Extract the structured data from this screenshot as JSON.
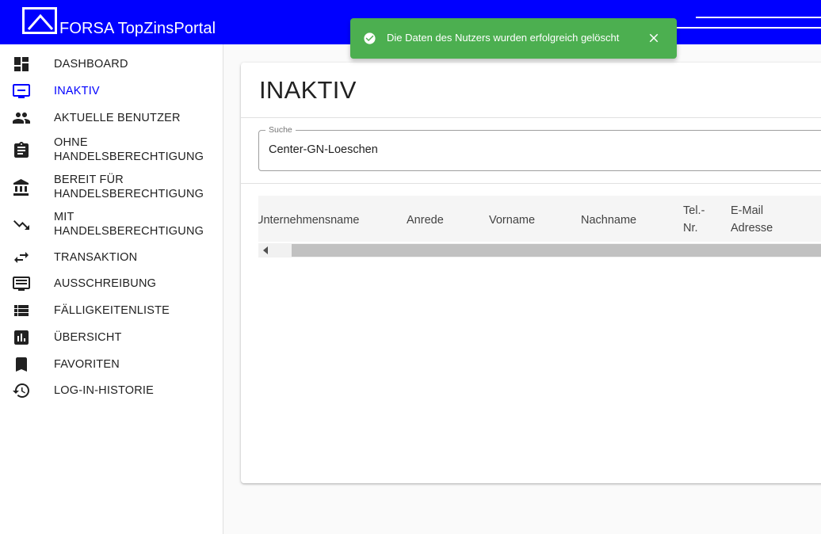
{
  "header": {
    "brand": "FORSA TopZinsPortal",
    "logo_icon": "house-roof-icon",
    "background": "#0000ff"
  },
  "sidebar": {
    "active_color": "#0000ff",
    "items": [
      {
        "label": "DASHBOARD",
        "icon": "dashboard-icon"
      },
      {
        "label": "INAKTIV",
        "icon": "monitor-icon",
        "active": true
      },
      {
        "label": "AKTUELLE BENUTZER",
        "icon": "people-icon"
      },
      {
        "label": "OHNE",
        "label2": "HANDELSBERECHTIGUNG",
        "icon": "clipboard-icon"
      },
      {
        "label": "BEREIT FÜR",
        "label2": "HANDELSBERECHTIGUNG",
        "icon": "bank-icon"
      },
      {
        "label": "MIT",
        "label2": "HANDELSBERECHTIGUNG",
        "icon": "trending-down-icon"
      },
      {
        "label": "TRANSAKTION",
        "icon": "swap-icon"
      },
      {
        "label": "AUSSCHREIBUNG",
        "icon": "message-box-icon"
      },
      {
        "label": "FÄLLIGKEITENLISTE",
        "icon": "list-icon"
      },
      {
        "label": "ÜBERSICHT",
        "icon": "bar-chart-icon"
      },
      {
        "label": "FAVORITEN",
        "icon": "bookmark-icon"
      },
      {
        "label": "LOG-IN-HISTORIE",
        "icon": "history-icon"
      }
    ]
  },
  "main": {
    "title": "INAKTIV",
    "search": {
      "label": "Suche",
      "value": "Center-GN-Loeschen"
    },
    "table": {
      "columns": [
        {
          "label": "Unternehmensname"
        },
        {
          "label": "Anrede"
        },
        {
          "label": "Vorname"
        },
        {
          "label": "Nachname"
        },
        {
          "label": "Tel.-",
          "label2": "Nr."
        },
        {
          "label": "E-Mail",
          "label2": "Adresse"
        }
      ]
    }
  },
  "toast": {
    "message": "Die Daten des Nutzers wurden erfolgreich gelöscht",
    "color": "#4caf50",
    "icon": "check-circle-icon",
    "close_icon": "close-icon"
  }
}
